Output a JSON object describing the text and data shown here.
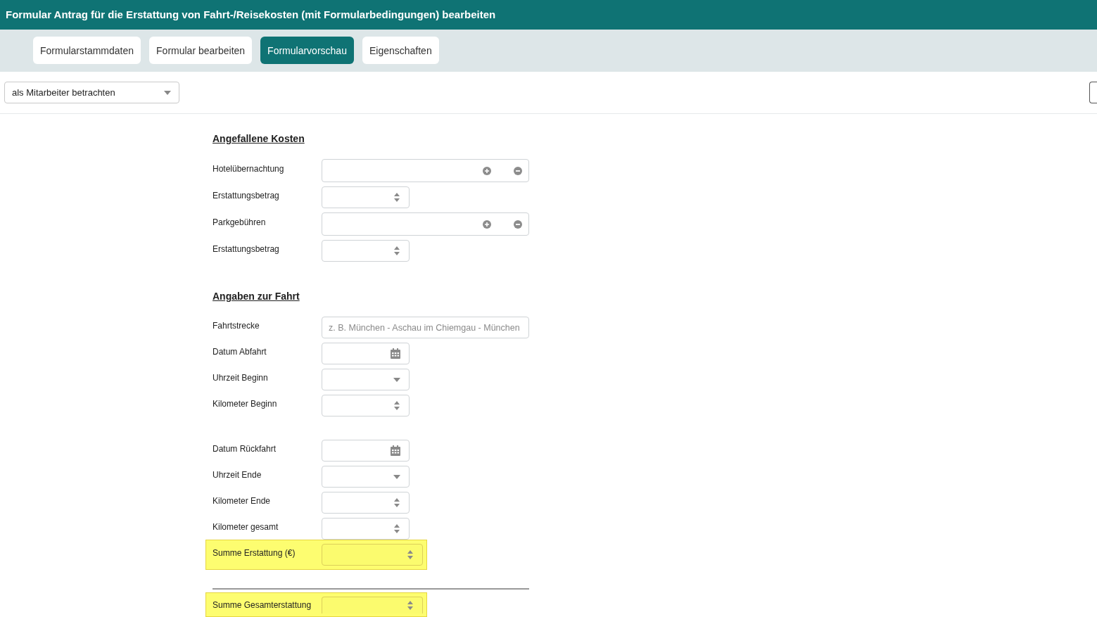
{
  "window": {
    "title": "Formular Antrag für die Erstattung von Fahrt-/Reisekosten (mit Formularbedingungen) bearbeiten"
  },
  "tabs": [
    {
      "label": "Formularstammdaten",
      "selected": false
    },
    {
      "label": "Formular bearbeiten",
      "selected": false
    },
    {
      "label": "Formularvorschau",
      "selected": true
    },
    {
      "label": "Eigenschaften",
      "selected": false
    }
  ],
  "toolbar": {
    "view_select": {
      "value": "als Mitarbeiter betrachten"
    }
  },
  "form": {
    "sections": [
      {
        "heading": "Angefallene Kosten",
        "groups": [
          {
            "fields": [
              {
                "label": "Hotelübernachtung",
                "kind": "list",
                "highlighted": false
              },
              {
                "label": "Erstattungsbetrag",
                "kind": "number",
                "highlighted": false
              },
              {
                "label": "Parkgebühren",
                "kind": "list",
                "highlighted": false
              },
              {
                "label": "Erstattungsbetrag",
                "kind": "number",
                "highlighted": false
              }
            ]
          }
        ]
      },
      {
        "heading": "Angaben zur Fahrt",
        "groups": [
          {
            "fields": [
              {
                "label": "Fahrtstrecke",
                "kind": "text",
                "placeholder": "z. B. München - Aschau im Chiemgau - München",
                "highlighted": false
              },
              {
                "label": "Datum Abfahrt",
                "kind": "date",
                "highlighted": false
              },
              {
                "label": "Uhrzeit Beginn",
                "kind": "time",
                "highlighted": false
              },
              {
                "label": "Kilometer Beginn",
                "kind": "number",
                "highlighted": false
              }
            ]
          },
          {
            "fields": [
              {
                "label": "Datum Rückfahrt",
                "kind": "date",
                "highlighted": false
              },
              {
                "label": "Uhrzeit Ende",
                "kind": "time",
                "highlighted": false
              },
              {
                "label": "Kilometer Ende",
                "kind": "number",
                "highlighted": false
              },
              {
                "label": "Kilometer gesamt",
                "kind": "number",
                "highlighted": false
              },
              {
                "label": "Summe Erstattung (€)",
                "kind": "number",
                "highlighted": true
              }
            ]
          }
        ]
      }
    ],
    "summary": {
      "fields": [
        {
          "label": "Summe Gesamterstattung",
          "kind": "number",
          "highlighted": true
        }
      ]
    }
  }
}
